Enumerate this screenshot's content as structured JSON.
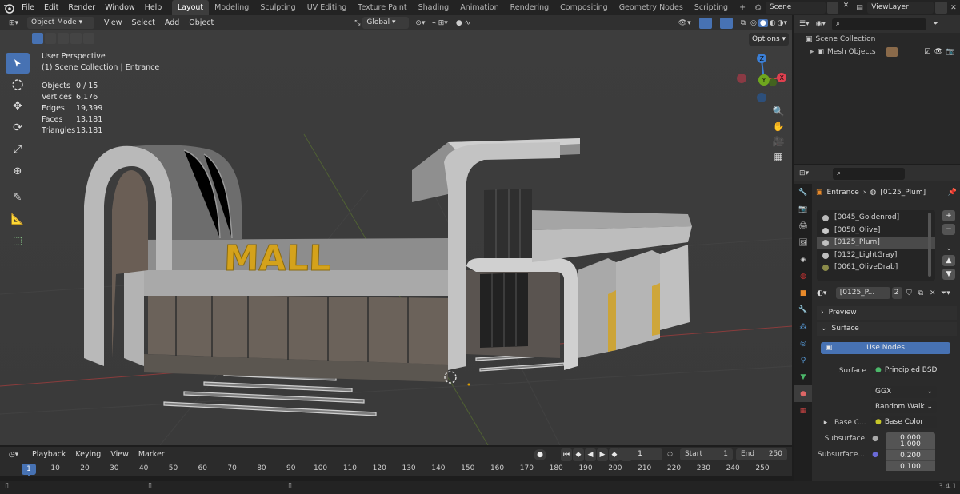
{
  "app": {
    "logo_icon": "blender-icon",
    "version": "3.4.1"
  },
  "menus": [
    "File",
    "Edit",
    "Render",
    "Window",
    "Help"
  ],
  "workspaces": {
    "active": "Layout",
    "tabs": [
      "Layout",
      "Modeling",
      "Sculpting",
      "UV Editing",
      "Texture Paint",
      "Shading",
      "Animation",
      "Rendering",
      "Compositing",
      "Geometry Nodes",
      "Scripting"
    ],
    "add": "+"
  },
  "scene": {
    "name": "Scene",
    "view_layer": "ViewLayer"
  },
  "viewport_header": {
    "mode": "Object Mode",
    "menus": [
      "View",
      "Select",
      "Add",
      "Object"
    ],
    "orientation": "Global",
    "options": "Options"
  },
  "overlay": {
    "perspective": "User Perspective",
    "collection": "(1) Scene Collection | Entrance",
    "stats": [
      {
        "k": "Objects",
        "v": "0 / 15"
      },
      {
        "k": "Vertices",
        "v": "6,176"
      },
      {
        "k": "Edges",
        "v": "19,399"
      },
      {
        "k": "Faces",
        "v": "13,181"
      },
      {
        "k": "Triangles",
        "v": "13,181"
      }
    ]
  },
  "gizmo": {
    "x": "X",
    "y": "Y",
    "z": "Z",
    "colors": {
      "x": "#e0404f",
      "y": "#6ea61e",
      "z": "#3b7fd6"
    }
  },
  "scene_art": {
    "sign": "MALL"
  },
  "outliner": {
    "root": "Scene Collection",
    "child": "Mesh Objects"
  },
  "properties": {
    "breadcrumb_object": "Entrance",
    "breadcrumb_material": "[0125_Plum]",
    "materials": [
      {
        "name": "[0045_Goldenrod]",
        "color": "#b8b8b8",
        "selected": false
      },
      {
        "name": "[0058_Olive]",
        "color": "#c9c9c9",
        "selected": false
      },
      {
        "name": "[0125_Plum]",
        "color": "#c0c0c0",
        "selected": true
      },
      {
        "name": "[0132_LightGray]",
        "color": "#bfbfbf",
        "selected": false
      },
      {
        "name": "[0061_OliveDrab]",
        "color": "#8c8c4a",
        "selected": false
      }
    ],
    "slot_name": "[0125_P...",
    "user_count": "2",
    "preview_label": "Preview",
    "surface_label": "Surface",
    "use_nodes": "Use Nodes",
    "surface_row": {
      "label": "Surface",
      "value": "Principled BSDF"
    },
    "distribution": "GGX",
    "subsurface_method": "Random Walk",
    "base_color": {
      "label": "Base C...",
      "value": "Base Color"
    },
    "subsurface": {
      "label": "Subsurface",
      "value": "0.000"
    },
    "subsurface_radius": {
      "label": "Subsurface...",
      "values": [
        "1.000",
        "0.200",
        "0.100"
      ]
    }
  },
  "timeline": {
    "menus": [
      "Playback",
      "Keying",
      "View",
      "Marker"
    ],
    "current_frame": "1",
    "start_label": "Start",
    "start": "1",
    "end_label": "End",
    "end": "250",
    "ruler": [
      "1",
      "10",
      "20",
      "30",
      "40",
      "50",
      "60",
      "70",
      "80",
      "90",
      "100",
      "110",
      "120",
      "130",
      "140",
      "150",
      "160",
      "170",
      "180",
      "190",
      "200",
      "210",
      "220",
      "230",
      "240",
      "250"
    ]
  },
  "colors": {
    "accent": "#4772b3",
    "bg": "#3e3e3e"
  }
}
